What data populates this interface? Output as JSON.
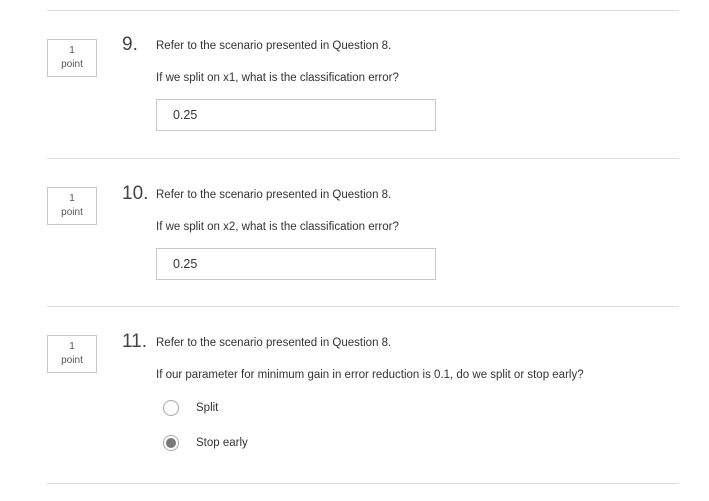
{
  "questions": [
    {
      "points_value": "1",
      "points_unit": "point",
      "number": "9.",
      "intro": "Refer to the scenario presented in Question 8.",
      "prompt": "If we split on x1, what is the classification error?",
      "answer": "0.25"
    },
    {
      "points_value": "1",
      "points_unit": "point",
      "number": "10.",
      "intro": "Refer to the scenario presented in Question 8.",
      "prompt": "If we split on x2, what is the classification error?",
      "answer": "0.25"
    },
    {
      "points_value": "1",
      "points_unit": "point",
      "number": "11.",
      "intro": "Refer to the scenario presented in Question 8.",
      "prompt": "If our parameter for minimum gain in error reduction is 0.1, do we split or stop early?",
      "options": [
        {
          "label": "Split",
          "selected": false
        },
        {
          "label": "Stop early",
          "selected": true
        }
      ]
    }
  ]
}
